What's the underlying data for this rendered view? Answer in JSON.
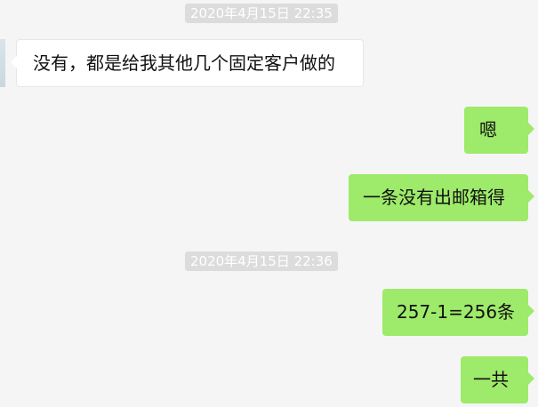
{
  "chat": {
    "timestamps": [
      "2020年4月15日 22:35",
      "2020年4月15日 22:36"
    ],
    "messages": [
      {
        "sender": "other",
        "text": "没有，都是给我其他几个固定客户做的"
      },
      {
        "sender": "self",
        "text": "嗯"
      },
      {
        "sender": "self",
        "text": "一条没有出邮箱得"
      },
      {
        "sender": "self",
        "text": "257-1=256条"
      },
      {
        "sender": "self",
        "text": "一共"
      }
    ]
  },
  "colors": {
    "background": "#f5f5f5",
    "incoming_bubble": "#ffffff",
    "outgoing_bubble": "#9eea6a",
    "timestamp_bg": "#dcdcdc",
    "timestamp_text": "#ffffff"
  }
}
